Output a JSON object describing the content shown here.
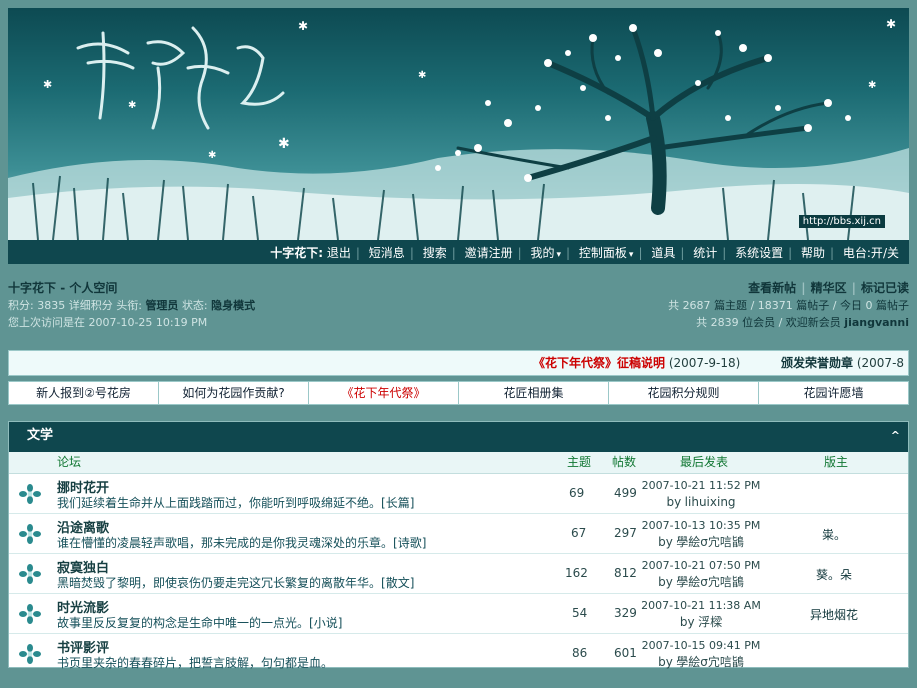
{
  "banner": {
    "url": "http://bbs.xij.cn"
  },
  "topnav": {
    "brand": "十字花下:",
    "items": [
      "退出",
      "短消息",
      "搜索",
      "邀请注册",
      "我的",
      "控制面板",
      "道具",
      "统计",
      "系统设置",
      "帮助"
    ],
    "radio_label": "电台:",
    "radio_on": "开",
    "radio_slash": "/",
    "radio_off": "关"
  },
  "info": {
    "site": "十字花下",
    "space": "- 个人空间",
    "credits_label": "积分:",
    "credits": "3835",
    "credits_detail": "详细积分",
    "title_label": "头衔:",
    "title": "管理员",
    "status_label": "状态:",
    "status": "隐身模式",
    "last_visit_label": "您上次访问是在",
    "last_visit": "2007-10-25 10:19 PM",
    "quick_links": [
      "查看新帖",
      "精华区",
      "标记已读"
    ],
    "stats_line1": {
      "pre": "共",
      "topics": "2687",
      "topics_label": "篇主题",
      "sep1": "/",
      "posts": "18371",
      "posts_label": "篇帖子",
      "sep2": "/",
      "today_label": "今日",
      "today": "0",
      "today_posts_label": "篇帖子"
    },
    "stats_line2": {
      "pre": "共",
      "members": "2839",
      "members_label": "位会员",
      "sep": "/",
      "welcome": "欢迎新会员",
      "newest": "jiangvanni"
    }
  },
  "announce": [
    {
      "title": "《花下年代祭》征稿说明",
      "date": "(2007-9-18)"
    },
    {
      "title": "颁发荣誉勋章",
      "date": "(2007-8"
    }
  ],
  "links": [
    "新人报到②号花房",
    "如何为花园作贡献?",
    "《花下年代祭》",
    "花匠相册集",
    "花园积分规则",
    "花园许愿墙"
  ],
  "forum": {
    "category": "文学",
    "collapse_icon": "^",
    "columns": {
      "forum": "论坛",
      "topics": "主题",
      "posts": "帖数",
      "last": "最后发表",
      "mod": "版主"
    },
    "rows": [
      {
        "name": "挪时花开",
        "desc": "我们延续着生命并从上面践踏而过，你能听到呼吸绵延不绝。",
        "tag": "[长篇]",
        "topics": "69",
        "posts": "499",
        "last_time": "2007-10-21 11:52 PM",
        "last_by": "by",
        "last_user": "lihuixing",
        "mod": ""
      },
      {
        "name": "沿途离歌",
        "desc": "谁在懵懂的凌晨轻声歌唱，那未完成的是你我灵魂深处的乐章。",
        "tag": "[诗歌]",
        "topics": "67",
        "posts": "297",
        "last_time": "2007-10-13 10:35 PM",
        "last_by": "by",
        "last_user": "學絵σ宂唁鴲",
        "mod": "粜。"
      },
      {
        "name": "寂寞独白",
        "desc": "黑暗焚毁了黎明，即使哀伤仍要走完这冗长繁复的离散年华。",
        "tag": "[散文]",
        "topics": "162",
        "posts": "812",
        "last_time": "2007-10-21 07:50 PM",
        "last_by": "by",
        "last_user": "學絵σ宂唁鴲",
        "mod": "葵。朵"
      },
      {
        "name": "时光流影",
        "desc": "故事里反反复复的构念是生命中唯一的一点光。",
        "tag": "[小说]",
        "topics": "54",
        "posts": "329",
        "last_time": "2007-10-21 11:38 AM",
        "last_by": "by",
        "last_user": "浮樑",
        "mod": "异地烟花"
      },
      {
        "name": "书评影评",
        "desc": "书页里夹杂的春春碎片，把誓言肢解，句句都是血。",
        "tag": "",
        "topics": "86",
        "posts": "601",
        "last_time": "2007-10-15 09:41 PM",
        "last_by": "by",
        "last_user": "學絵σ宂唁鴲",
        "mod": ""
      }
    ]
  }
}
